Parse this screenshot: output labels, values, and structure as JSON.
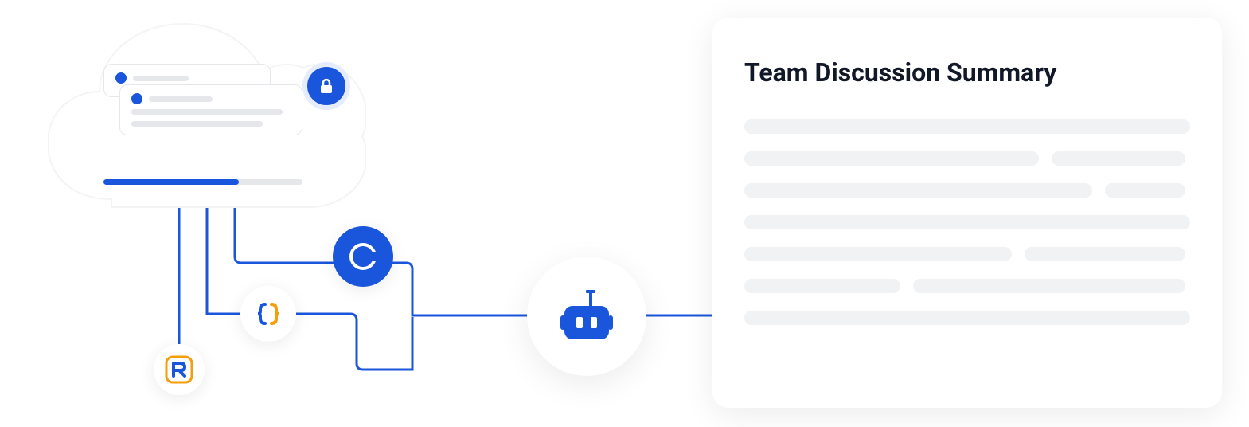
{
  "diagram": {
    "cloud": {
      "lock_icon": "lock",
      "progress_percent": 68,
      "message_cards": [
        {
          "lines": 1
        },
        {
          "lines": 3
        }
      ]
    },
    "nodes": {
      "c_node": {
        "label": "C",
        "color": "#1a56db"
      },
      "braces_node": {
        "icon": "braces",
        "colors": [
          "#1a56db",
          "#f59e0b"
        ]
      },
      "r_node": {
        "label": "R",
        "border_color": "#f59e0b",
        "text_color": "#1a56db"
      }
    },
    "robot": {
      "icon": "robot",
      "color": "#1a56db"
    },
    "connector_color": "#1a56db"
  },
  "summary": {
    "title": "Team Discussion Summary",
    "placeholder_rows": [
      [
        100
      ],
      [
        66,
        30
      ],
      [
        78,
        18
      ],
      [
        100
      ],
      [
        60,
        36
      ],
      [
        35,
        61
      ],
      [
        100
      ]
    ]
  }
}
